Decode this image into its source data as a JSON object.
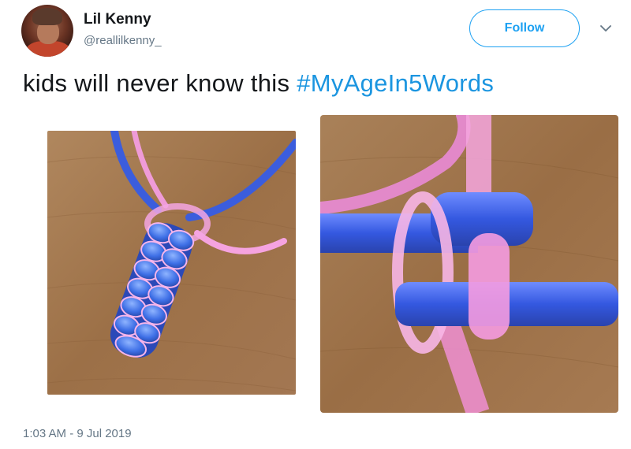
{
  "tweet": {
    "author": {
      "display_name": "Lil Kenny",
      "handle": "@reallilkenny_"
    },
    "follow_label": "Follow",
    "text_plain": "kids will never know this ",
    "hashtag": "#MyAgeIn5Words",
    "timestamp": "1:03 AM - 9 Jul 2019",
    "media": [
      {
        "description": "knotted blue and pink plastic lanyard keychain"
      },
      {
        "description": "close-up of blue and pink plastic lacing knot"
      }
    ]
  },
  "colors": {
    "accent": "#1da1f2",
    "hashtag": "#1b95e0",
    "secondary_text": "#657786",
    "primary_text": "#14171a"
  },
  "icons": [
    "chevron-down-icon"
  ]
}
